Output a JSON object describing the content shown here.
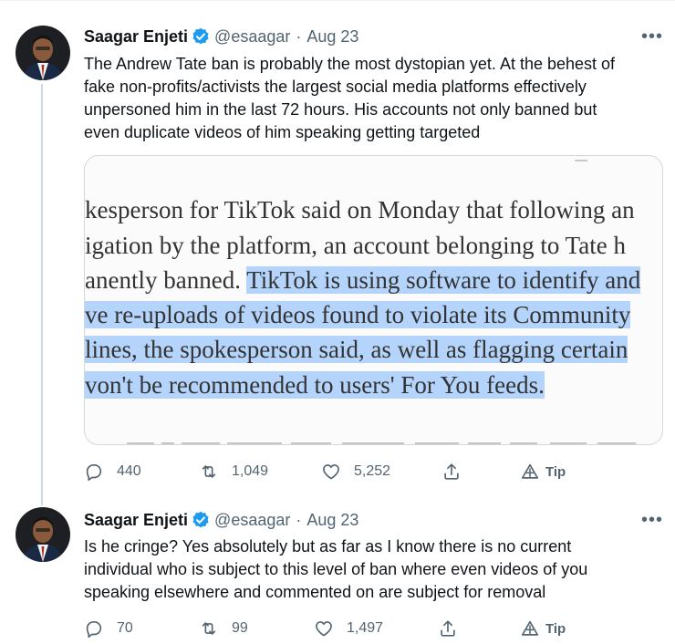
{
  "tweets": [
    {
      "author_name": "Saagar Enjeti",
      "handle": "@esaagar",
      "separator": "·",
      "date": "Aug 23",
      "more": "•••",
      "text_lines": [
        "The Andrew Tate ban is probably the most dystopian yet. At the behest of",
        "fake non-profits/activists the largest social media platforms effectively",
        "unpersoned him in the last 72 hours. His accounts not only banned but",
        "even duplicate videos of him speaking getting targeted"
      ],
      "media": {
        "lines": [
          {
            "plain": "kesperson for TikTok said on Monday that following an",
            "highlight": ""
          },
          {
            "plain": "igation by the platform, an account belonging to Tate h",
            "highlight": ""
          },
          {
            "plain": "anently banned. ",
            "highlight": "TikTok is using software to identify and"
          },
          {
            "plain": "",
            "highlight": "ve re-uploads of videos found to violate its Community"
          },
          {
            "plain": "",
            "highlight": "lines, the spokesperson said, as well as flagging certain"
          },
          {
            "plain": "",
            "highlight": "von't be recommended to users' For You feeds."
          }
        ],
        "highlight_color": "#b4d4fb"
      },
      "actions": {
        "replies": "440",
        "retweets": "1,049",
        "likes": "5,252",
        "tip": "Tip"
      }
    },
    {
      "author_name": "Saagar Enjeti",
      "handle": "@esaagar",
      "separator": "·",
      "date": "Aug 23",
      "more": "•••",
      "text_lines": [
        "Is he cringe? Yes absolutely but as far as I know there is no current",
        "individual who is subject to this level of ban where even videos of you",
        "speaking elsewhere and commented on are subject for removal"
      ],
      "actions": {
        "replies": "70",
        "retweets": "99",
        "likes": "1,497",
        "tip": "Tip"
      }
    }
  ],
  "colors": {
    "text": "#0f1419",
    "secondary": "#536471",
    "verified_blue": "#1d9bf0",
    "thread_line": "#cfd9de"
  },
  "icons": [
    "verified-badge-icon",
    "reply-icon",
    "retweet-icon",
    "like-icon",
    "share-icon",
    "tip-icon",
    "more-icon"
  ]
}
